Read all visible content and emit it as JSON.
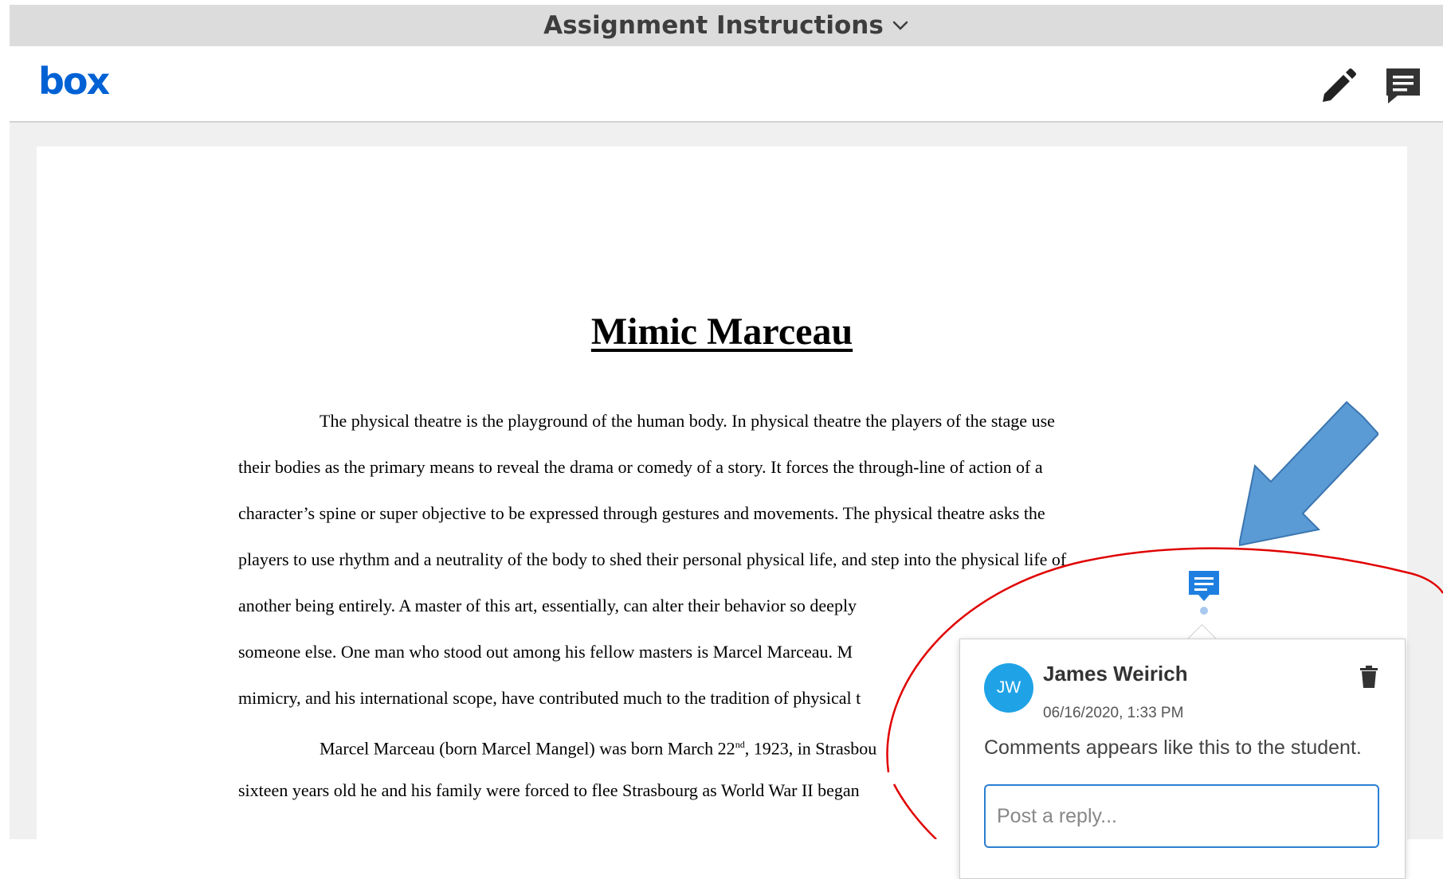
{
  "header": {
    "title": "Assignment Instructions"
  },
  "appbar": {
    "logo_text": "box",
    "pencil_icon": "pencil-icon",
    "comment_icon": "comment-icon"
  },
  "document": {
    "title": "Mimic Marceau",
    "lines": [
      "The physical theatre is the playground of the human body.   In physical theatre the players of the stage use",
      "their bodies as the primary means to reveal the drama or comedy of a story.   It forces the through-line of action of a",
      "character’s spine or super objective to be expressed through gestures and movements.   The physical theatre asks the",
      "players to use rhythm and a neutrality of the body to shed their personal physical life, and step into the physical life of",
      "another being entirely.   A master of this art, essentially, can alter their behavior so deeply",
      "someone else.   One man who stood out among his fellow masters is Marcel Marceau.   M",
      "mimicry, and his international scope, have contributed much to the tradition of physical t",
      "Marcel Marceau (born Marcel Mangel) was born March 22",
      "sixteen years old he and his family were forced to flee Strasbourg as World War II began"
    ],
    "line8_sup": "nd",
    "line8_rest": ", 1923, in Strasbou"
  },
  "comment": {
    "initials": "JW",
    "author": "James Weirich",
    "timestamp": "06/16/2020, 1:33 PM",
    "text": "Comments appears like this to the student.",
    "reply_placeholder": "Post a reply..."
  },
  "colors": {
    "accent": "#2a7fd4",
    "avatar": "#1fa3e6",
    "annotation_arrow": "#5b9bd5",
    "annotation_circle": "#e00000",
    "box_logo": "#0061d5"
  }
}
